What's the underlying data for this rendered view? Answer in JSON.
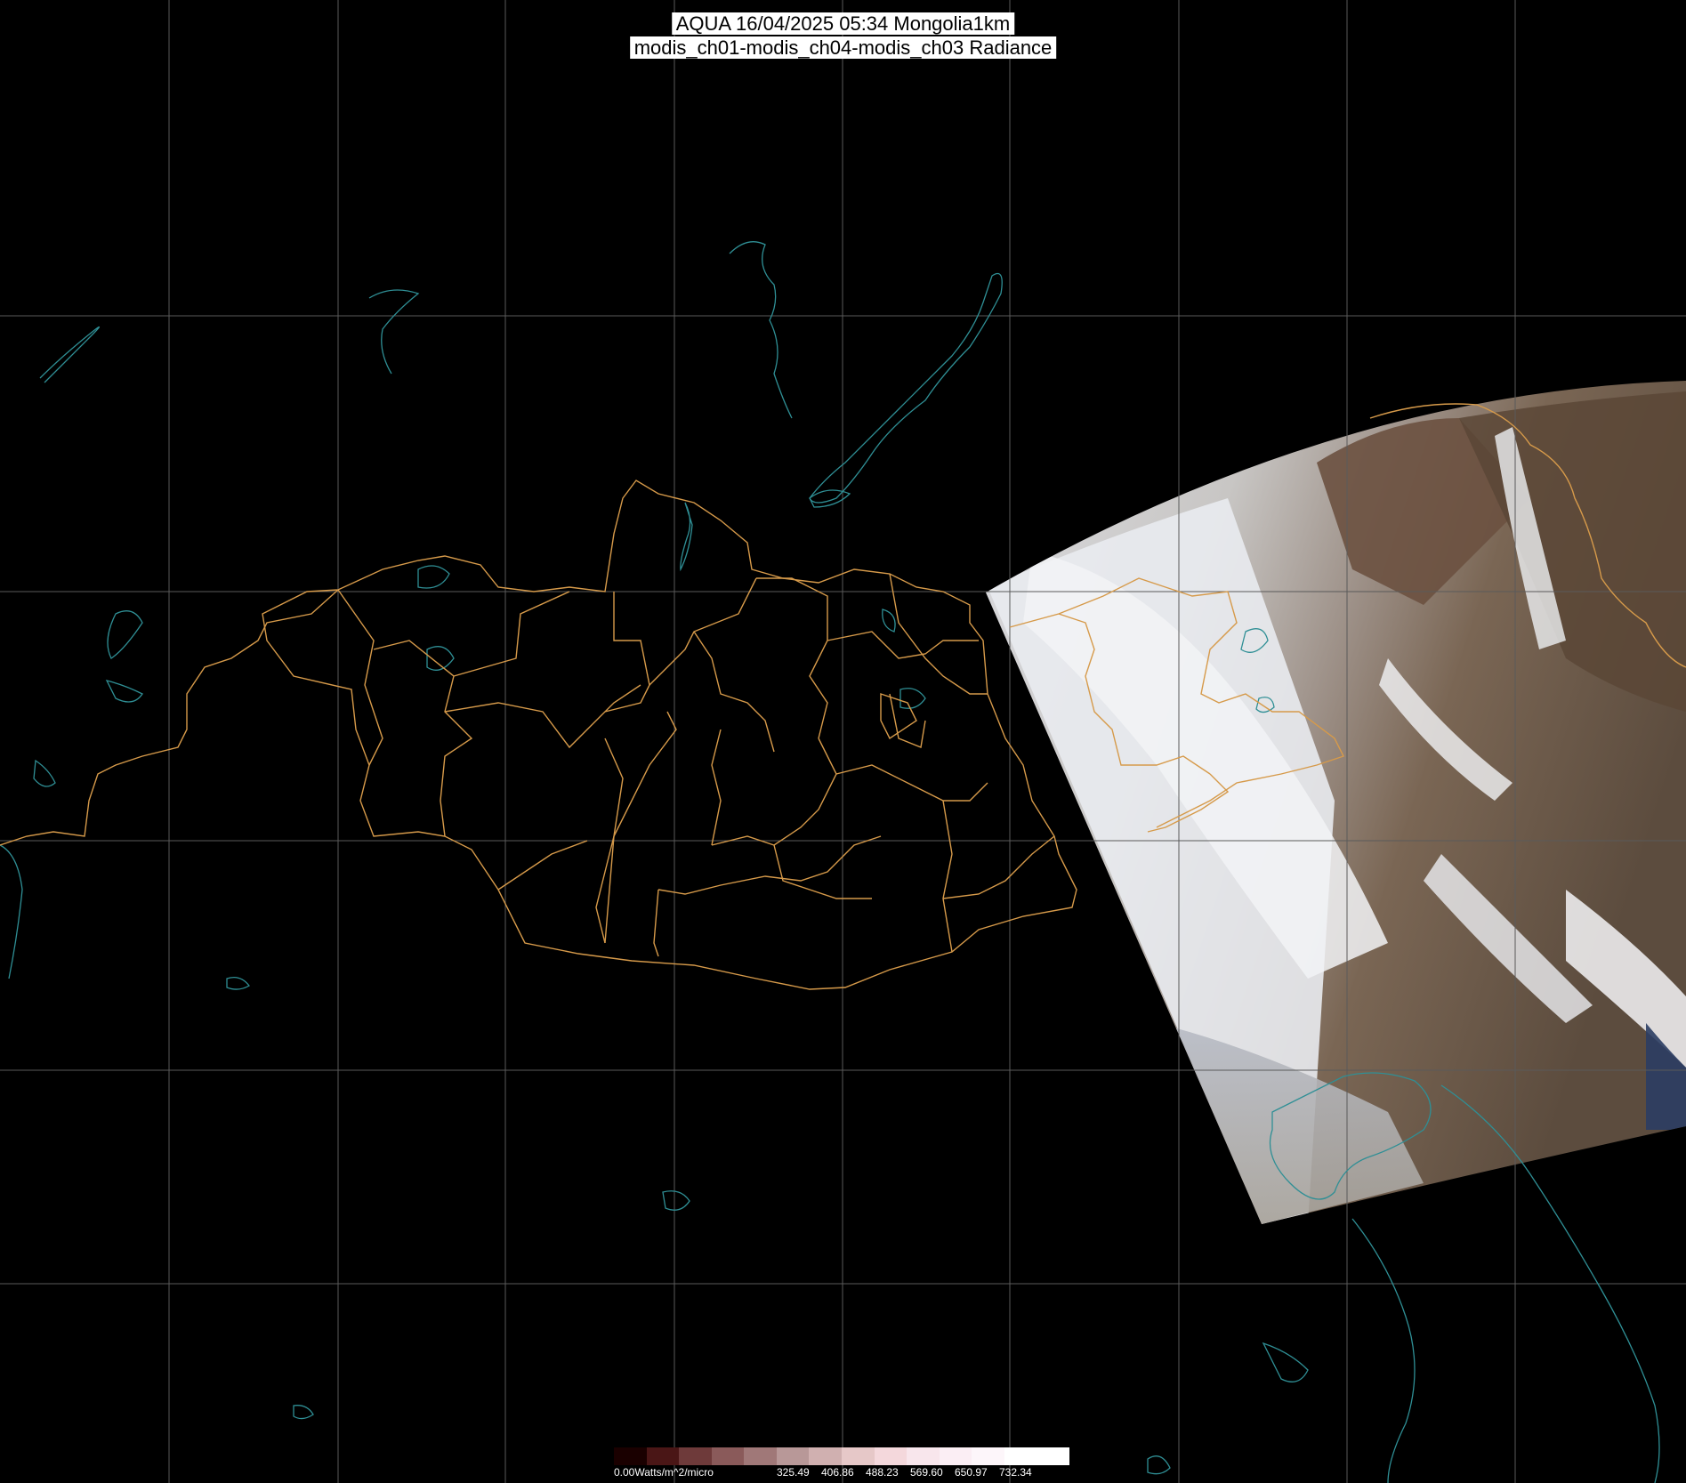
{
  "header": {
    "title_line1": "AQUA 16/04/2025 05:34 Mongolia1km",
    "title_line2": "modis_ch01-modis_ch04-modis_ch03 Radiance"
  },
  "legend": {
    "unit_label": "0.00Watts/m^2/micro",
    "ticks": [
      "325.49",
      "406.86",
      "488.23",
      "569.60",
      "650.97",
      "732.34"
    ],
    "colors": [
      "#1a0000",
      "#4a1616",
      "#6e3a3a",
      "#8a5a5a",
      "#a07878",
      "#b89898",
      "#d0b0b0",
      "#e6c8c8",
      "#f4d8dc",
      "#f8e6ec",
      "#fbeef4",
      "#fdf6fa",
      "#ffffff",
      "#ffffff"
    ]
  },
  "colors": {
    "background": "#000000",
    "grid": "#5a5a5a",
    "coastline": "#2f8f95",
    "admin_boundary": "#d69a4a"
  }
}
